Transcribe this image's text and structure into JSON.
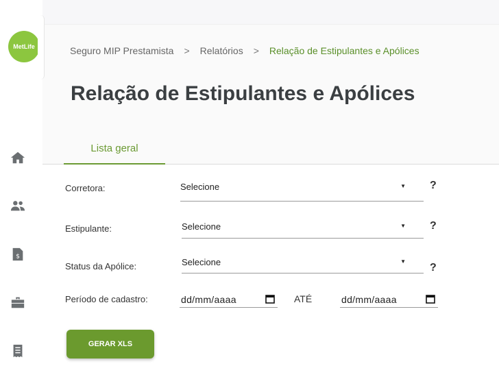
{
  "logo": {
    "text": "MetLife",
    "color": "#8cc63f"
  },
  "sidebar": {
    "items": [
      {
        "icon": "home-icon"
      },
      {
        "icon": "users-icon"
      },
      {
        "icon": "invoice-icon"
      },
      {
        "icon": "briefcase-icon"
      },
      {
        "icon": "receipt-icon"
      }
    ]
  },
  "breadcrumb": {
    "items": [
      "Seguro MIP Prestamista",
      "Relatórios",
      "Relação de Estipulantes e Apólices"
    ],
    "separator": ">"
  },
  "page": {
    "title": "Relação de Estipulantes e Apólices"
  },
  "tabs": [
    {
      "label": "Lista geral",
      "active": true
    }
  ],
  "form": {
    "corretora": {
      "label": "Corretora:",
      "value": "Selecione"
    },
    "estipulante": {
      "label": "Estipulante:",
      "value": "Selecione"
    },
    "status": {
      "label": "Status da Apólice:",
      "value": "Selecione"
    },
    "periodo": {
      "label": "Período de cadastro:",
      "from": "dd/mm/aaaa",
      "separator": "ATÉ",
      "to": "dd/mm/aaaa"
    },
    "help": "?",
    "button_label": "GERAR XLS"
  },
  "colors": {
    "accent": "#6b9a2e",
    "breadcrumb_active": "#5a8f29"
  }
}
